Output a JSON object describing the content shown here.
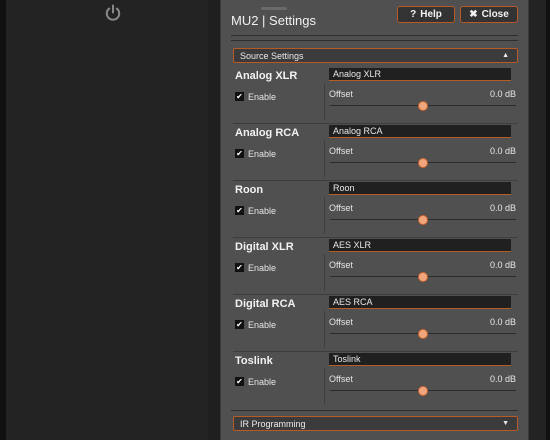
{
  "window": {
    "title": "MU2 | Settings"
  },
  "header": {
    "help_label": "Help",
    "close_label": "Close"
  },
  "source_settings": {
    "label": "Source Settings",
    "caret": "▲",
    "sources": [
      {
        "name": "Analog XLR",
        "input_value": "Analog XLR",
        "enable_label": "Enable",
        "enabled": true,
        "offset_label": "Offset",
        "offset_value": "0.0 dB",
        "slider_fraction": 0.5
      },
      {
        "name": "Analog RCA",
        "input_value": "Analog RCA",
        "enable_label": "Enable",
        "enabled": true,
        "offset_label": "Offset",
        "offset_value": "0.0 dB",
        "slider_fraction": 0.5
      },
      {
        "name": "Roon",
        "input_value": "Roon",
        "enable_label": "Enable",
        "enabled": true,
        "offset_label": "Offset",
        "offset_value": "0.0 dB",
        "slider_fraction": 0.5
      },
      {
        "name": "Digital XLR",
        "input_value": "AES XLR",
        "enable_label": "Enable",
        "enabled": true,
        "offset_label": "Offset",
        "offset_value": "0.0 dB",
        "slider_fraction": 0.5
      },
      {
        "name": "Digital RCA",
        "input_value": "AES RCA",
        "enable_label": "Enable",
        "enabled": true,
        "offset_label": "Offset",
        "offset_value": "0.0 dB",
        "slider_fraction": 0.5
      },
      {
        "name": "Toslink",
        "input_value": "Toslink",
        "enable_label": "Enable",
        "enabled": true,
        "offset_label": "Offset",
        "offset_value": "0.0 dB",
        "slider_fraction": 0.5
      }
    ]
  },
  "ir_programming": {
    "label": "IR Programming",
    "caret": "▼"
  },
  "icons": {
    "power": "power-icon",
    "help": "question-icon",
    "close": "x-icon",
    "check": "checkmark-icon"
  },
  "colors": {
    "accent": "#b65a29",
    "slider_thumb": "#f0a57d",
    "panel": "#505050",
    "background": "#1f1f1f"
  }
}
